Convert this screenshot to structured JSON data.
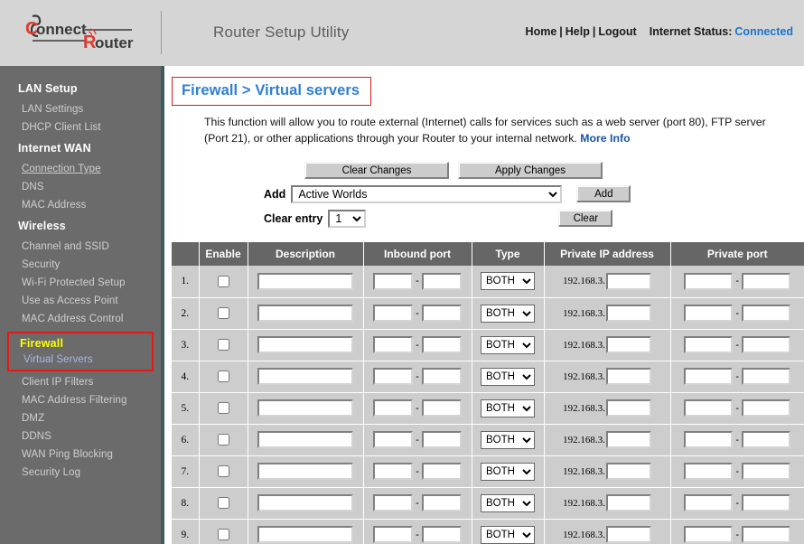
{
  "header": {
    "logo_text_primary": "onnect",
    "logo_text_secondary": "outer",
    "logo_letter_c": "C",
    "logo_letter_r": "R",
    "app_title": "Router Setup Utility",
    "links": [
      {
        "label": "Home"
      },
      {
        "label": "Help"
      },
      {
        "label": "Logout"
      }
    ],
    "divider": "|",
    "status_label": "Internet Status:",
    "status_value": "Connected",
    "status_color": "#1874cd"
  },
  "sidebar": {
    "background": "#6b6b6b",
    "groups": [
      {
        "title": "LAN Setup",
        "items": [
          {
            "label": "LAN Settings",
            "state": "normal"
          },
          {
            "label": "DHCP Client List",
            "state": "normal"
          }
        ]
      },
      {
        "title": "Internet WAN",
        "items": [
          {
            "label": "Connection Type",
            "state": "underlined"
          },
          {
            "label": "DNS",
            "state": "normal"
          },
          {
            "label": "MAC Address",
            "state": "normal"
          }
        ]
      },
      {
        "title": "Wireless",
        "items": [
          {
            "label": "Channel and SSID",
            "state": "normal"
          },
          {
            "label": "Security",
            "state": "normal"
          },
          {
            "label": "Wi-Fi Protected Setup",
            "state": "normal"
          },
          {
            "label": "Use as Access Point",
            "state": "normal"
          },
          {
            "label": "MAC Address Control",
            "state": "normal"
          }
        ]
      }
    ],
    "firewall_group": {
      "title": "Firewall",
      "title_color": "#ffff00",
      "highlight_border_color": "#e11919",
      "active_item": {
        "label": "Virtual Servers",
        "color": "#a8b6ee"
      }
    },
    "firewall_rest": [
      {
        "label": "Client IP Filters"
      },
      {
        "label": "MAC Address Filtering"
      },
      {
        "label": "DMZ"
      },
      {
        "label": "DDNS"
      },
      {
        "label": "WAN Ping Blocking"
      },
      {
        "label": "Security Log"
      }
    ]
  },
  "main": {
    "page_title": "Firewall > Virtual servers",
    "page_title_color": "#2e7fd4",
    "title_box_border": "#e11919",
    "description": "This function will allow you to route external (Internet) calls for services such as a web server (port 80), FTP server (Port 21), or other applications through your Router to your internal network. ",
    "description_link": "More Info",
    "buttons": {
      "clear_changes": "Clear Changes",
      "apply_changes": "Apply Changes",
      "add": "Add",
      "clear": "Clear"
    },
    "add_row": {
      "label": "Add",
      "selected": "Active Worlds"
    },
    "clear_entry_row": {
      "label": "Clear entry",
      "selected": "1"
    },
    "table": {
      "headers": [
        "",
        "Enable",
        "Description",
        "Inbound port",
        "Type",
        "Private IP address",
        "Private port"
      ],
      "ip_prefix": "192.168.3.",
      "port_separator": "-",
      "type_default": "BOTH",
      "rows": [
        {
          "index": "1.",
          "enabled": false,
          "description": "",
          "inbound_from": "",
          "inbound_to": "",
          "type": "BOTH",
          "private_ip_suffix": "",
          "private_from": "",
          "private_to": ""
        },
        {
          "index": "2.",
          "enabled": false,
          "description": "",
          "inbound_from": "",
          "inbound_to": "",
          "type": "BOTH",
          "private_ip_suffix": "",
          "private_from": "",
          "private_to": ""
        },
        {
          "index": "3.",
          "enabled": false,
          "description": "",
          "inbound_from": "",
          "inbound_to": "",
          "type": "BOTH",
          "private_ip_suffix": "",
          "private_from": "",
          "private_to": ""
        },
        {
          "index": "4.",
          "enabled": false,
          "description": "",
          "inbound_from": "",
          "inbound_to": "",
          "type": "BOTH",
          "private_ip_suffix": "",
          "private_from": "",
          "private_to": ""
        },
        {
          "index": "5.",
          "enabled": false,
          "description": "",
          "inbound_from": "",
          "inbound_to": "",
          "type": "BOTH",
          "private_ip_suffix": "",
          "private_from": "",
          "private_to": ""
        },
        {
          "index": "6.",
          "enabled": false,
          "description": "",
          "inbound_from": "",
          "inbound_to": "",
          "type": "BOTH",
          "private_ip_suffix": "",
          "private_from": "",
          "private_to": ""
        },
        {
          "index": "7.",
          "enabled": false,
          "description": "",
          "inbound_from": "",
          "inbound_to": "",
          "type": "BOTH",
          "private_ip_suffix": "",
          "private_from": "",
          "private_to": ""
        },
        {
          "index": "8.",
          "enabled": false,
          "description": "",
          "inbound_from": "",
          "inbound_to": "",
          "type": "BOTH",
          "private_ip_suffix": "",
          "private_from": "",
          "private_to": ""
        },
        {
          "index": "9.",
          "enabled": false,
          "description": "",
          "inbound_from": "",
          "inbound_to": "",
          "type": "BOTH",
          "private_ip_suffix": "",
          "private_from": "",
          "private_to": ""
        }
      ]
    }
  }
}
